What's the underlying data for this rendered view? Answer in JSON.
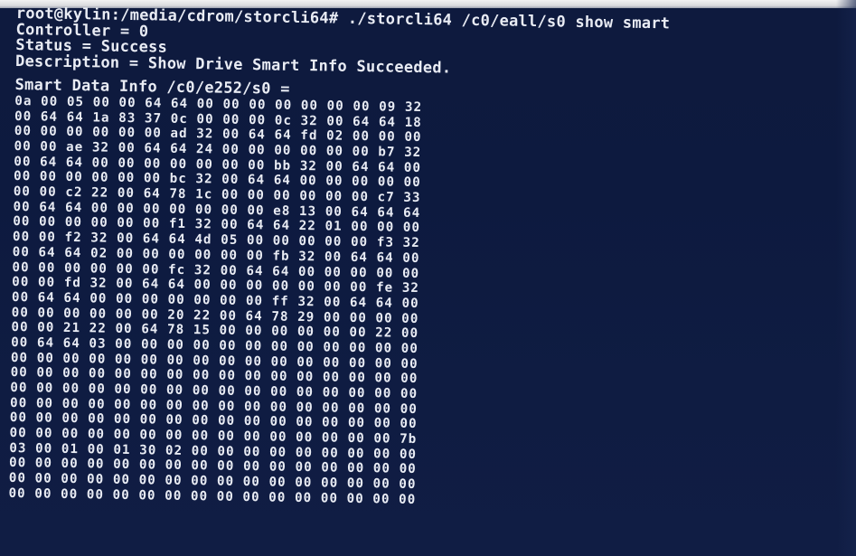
{
  "terminal": {
    "command_line": "root@kylin:/media/cdrom/storcli64# ./storcli64 /c0/eall/s0 show smart",
    "controller_line": "Controller = 0",
    "status_line": "Status = Success",
    "description_line": "Description = Show Drive Smart Info Succeeded.",
    "smart_header": "Smart Data Info /c0/e252/s0 =",
    "hex_rows": [
      "0a 00 05 00 00 64 64 00 00 00 00 00 00 00 09 32",
      "00 64 64 1a 83 37 0c 00 00 00 0c 32 00 64 64 18",
      "00 00 00 00 00 00 ad 32 00 64 64 fd 02 00 00 00",
      "00 00 ae 32 00 64 64 24 00 00 00 00 00 00 b7 32",
      "00 64 64 00 00 00 00 00 00 00 bb 32 00 64 64 00",
      "00 00 00 00 00 00 bc 32 00 64 64 00 00 00 00 00",
      "00 00 c2 22 00 64 78 1c 00 00 00 00 00 00 c7 33",
      "00 64 64 00 00 00 00 00 00 00 e8 13 00 64 64 64",
      "00 00 00 00 00 00 f1 32 00 64 64 22 01 00 00 00",
      "00 00 f2 32 00 64 64 4d 05 00 00 00 00 00 f3 32",
      "00 64 64 02 00 00 00 00 00 00 fb 32 00 64 64 00",
      "00 00 00 00 00 00 fc 32 00 64 64 00 00 00 00 00",
      "00 00 fd 32 00 64 64 00 00 00 00 00 00 00 fe 32",
      "00 64 64 00 00 00 00 00 00 00 ff 32 00 64 64 00",
      "00 00 00 00 00 00 20 22 00 64 78 29 00 00 00 00",
      "00 00 21 22 00 64 78 15 00 00 00 00 00 00 22 00",
      "00 64 64 03 00 00 00 00 00 00 00 00 00 00 00 00",
      "00 00 00 00 00 00 00 00 00 00 00 00 00 00 00 00",
      "00 00 00 00 00 00 00 00 00 00 00 00 00 00 00 00",
      "00 00 00 00 00 00 00 00 00 00 00 00 00 00 00 00",
      "00 00 00 00 00 00 00 00 00 00 00 00 00 00 00 00",
      "00 00 00 00 00 00 00 00 00 00 00 00 00 00 00 00",
      "00 00 00 00 00 00 00 00 00 00 00 00 00 00 00 7b",
      "03 00 01 00 01 30 02 00 00 00 00 00 00 00 00 00",
      "00 00 00 00 00 00 00 00 00 00 00 00 00 00 00 00",
      "00 00 00 00 00 00 00 00 00 00 00 00 00 00 00 00",
      "00 00 00 00 00 00 00 00 00 00 00 00 00 00 00 00"
    ]
  }
}
